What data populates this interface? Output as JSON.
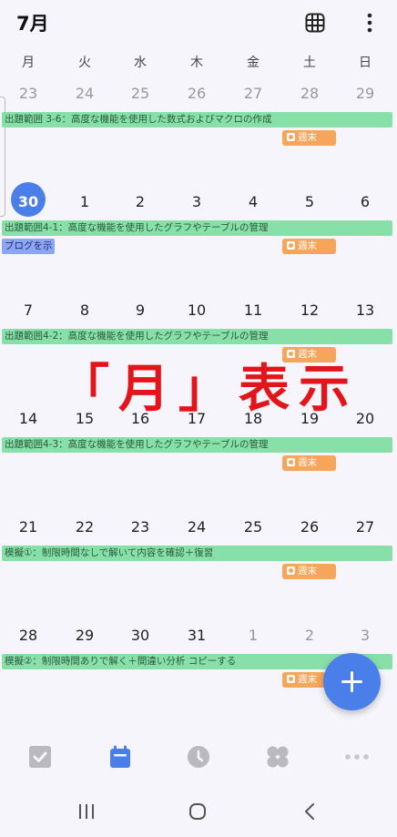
{
  "header": {
    "month": "7月",
    "grid_icon": "calendar-grid-icon",
    "more_icon": "more-vertical-icon"
  },
  "weekdays": [
    "月",
    "火",
    "水",
    "木",
    "金",
    "土",
    "日"
  ],
  "weeks": [
    {
      "days": [
        "23",
        "24",
        "25",
        "26",
        "27",
        "28",
        "29"
      ],
      "dim": [
        true,
        true,
        true,
        true,
        true,
        true,
        true
      ],
      "event": "出題範囲 3-6：高度な機能を使用した数式およびマクロの作成",
      "weekend": "週末"
    },
    {
      "days": [
        "30",
        "1",
        "2",
        "3",
        "4",
        "5",
        "6"
      ],
      "dim": [
        false,
        false,
        false,
        false,
        false,
        false,
        false
      ],
      "today_index": 0,
      "event": "出題範囲4-1：高度な機能を使用したグラフやテーブルの管理",
      "weekend": "週末",
      "blog": "ブログを示"
    },
    {
      "days": [
        "7",
        "8",
        "9",
        "10",
        "11",
        "12",
        "13"
      ],
      "dim": [
        false,
        false,
        false,
        false,
        false,
        false,
        false
      ],
      "event": "出題範囲4-2：高度な機能を使用したグラフやテーブルの管理",
      "weekend": "週末"
    },
    {
      "days": [
        "14",
        "15",
        "16",
        "17",
        "18",
        "19",
        "20"
      ],
      "dim": [
        false,
        false,
        false,
        false,
        false,
        false,
        false
      ],
      "event": "出題範囲4-3：高度な機能を使用したグラフやテーブルの管理",
      "weekend": "週末"
    },
    {
      "days": [
        "21",
        "22",
        "23",
        "24",
        "25",
        "26",
        "27"
      ],
      "dim": [
        false,
        false,
        false,
        false,
        false,
        false,
        false
      ],
      "event": "模擬①：制限時間なしで解いて内容を確認＋復習",
      "weekend": "週末"
    },
    {
      "days": [
        "28",
        "29",
        "30",
        "31",
        "1",
        "2",
        "3"
      ],
      "dim": [
        false,
        false,
        false,
        false,
        true,
        true,
        true
      ],
      "event": "模擬②：制限時間ありで解く＋間違い分析 コピーする",
      "weekend": "週末"
    }
  ],
  "overlay": "「月」表示",
  "colors": {
    "accent": "#4a7ee8",
    "event_green": "#86e0a8",
    "weekend_orange": "#f6a65a",
    "blog_blue": "#8ea6f2",
    "overlay_red": "#e4141b"
  },
  "fab_icon": "add-icon",
  "tabs": [
    {
      "icon": "task-checkbox-icon",
      "active": false
    },
    {
      "icon": "calendar-icon",
      "active": true
    },
    {
      "icon": "clock-icon",
      "active": false
    },
    {
      "icon": "apps-icon",
      "active": false
    },
    {
      "icon": "more-horizontal-icon",
      "active": false
    }
  ],
  "system_nav": [
    "recent-apps-icon",
    "home-icon",
    "back-icon"
  ]
}
